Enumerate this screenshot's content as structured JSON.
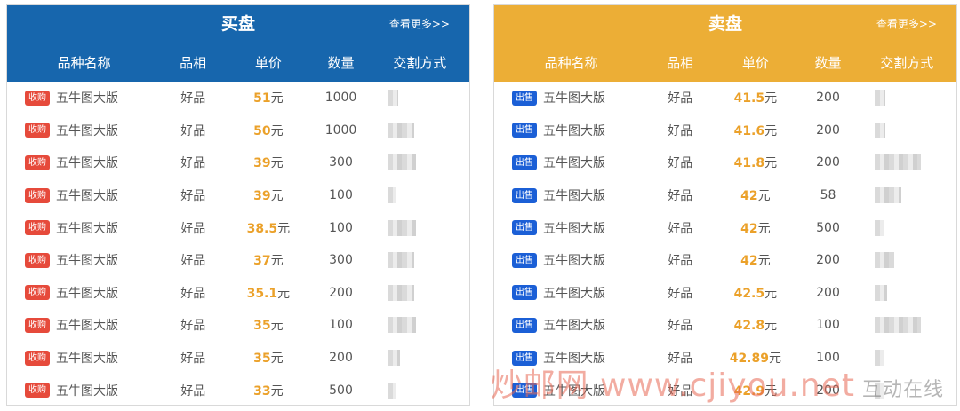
{
  "buy": {
    "title": "买盘",
    "more": "查看更多>>",
    "columns": [
      "品种名称",
      "品相",
      "单价",
      "数量",
      "交割方式"
    ],
    "rows": [
      {
        "tag": "收购",
        "name": "五牛图大版",
        "quality": "好品",
        "price": "51",
        "unit": "元",
        "qty": "1000"
      },
      {
        "tag": "收购",
        "name": "五牛图大版",
        "quality": "好品",
        "price": "50",
        "unit": "元",
        "qty": "1000"
      },
      {
        "tag": "收购",
        "name": "五牛图大版",
        "quality": "好品",
        "price": "39",
        "unit": "元",
        "qty": "300"
      },
      {
        "tag": "收购",
        "name": "五牛图大版",
        "quality": "好品",
        "price": "39",
        "unit": "元",
        "qty": "100"
      },
      {
        "tag": "收购",
        "name": "五牛图大版",
        "quality": "好品",
        "price": "38.5",
        "unit": "元",
        "qty": "100"
      },
      {
        "tag": "收购",
        "name": "五牛图大版",
        "quality": "好品",
        "price": "37",
        "unit": "元",
        "qty": "300"
      },
      {
        "tag": "收购",
        "name": "五牛图大版",
        "quality": "好品",
        "price": "35.1",
        "unit": "元",
        "qty": "200"
      },
      {
        "tag": "收购",
        "name": "五牛图大版",
        "quality": "好品",
        "price": "35",
        "unit": "元",
        "qty": "100"
      },
      {
        "tag": "收购",
        "name": "五牛图大版",
        "quality": "好品",
        "price": "35",
        "unit": "元",
        "qty": "200"
      },
      {
        "tag": "收购",
        "name": "五牛图大版",
        "quality": "好品",
        "price": "33",
        "unit": "元",
        "qty": "500"
      }
    ]
  },
  "sell": {
    "title": "卖盘",
    "more": "查看更多>>",
    "columns": [
      "品种名称",
      "品相",
      "单价",
      "数量",
      "交割方式"
    ],
    "rows": [
      {
        "tag": "出售",
        "name": "五牛图大版",
        "quality": "好品",
        "price": "41.5",
        "unit": "元",
        "qty": "200"
      },
      {
        "tag": "出售",
        "name": "五牛图大版",
        "quality": "好品",
        "price": "41.6",
        "unit": "元",
        "qty": "200"
      },
      {
        "tag": "出售",
        "name": "五牛图大版",
        "quality": "好品",
        "price": "41.8",
        "unit": "元",
        "qty": "200"
      },
      {
        "tag": "出售",
        "name": "五牛图大版",
        "quality": "好品",
        "price": "42",
        "unit": "元",
        "qty": "58"
      },
      {
        "tag": "出售",
        "name": "五牛图大版",
        "quality": "好品",
        "price": "42",
        "unit": "元",
        "qty": "500"
      },
      {
        "tag": "出售",
        "name": "五牛图大版",
        "quality": "好品",
        "price": "42",
        "unit": "元",
        "qty": "200"
      },
      {
        "tag": "出售",
        "name": "五牛图大版",
        "quality": "好品",
        "price": "42.5",
        "unit": "元",
        "qty": "200"
      },
      {
        "tag": "出售",
        "name": "五牛图大版",
        "quality": "好品",
        "price": "42.8",
        "unit": "元",
        "qty": "100"
      },
      {
        "tag": "出售",
        "name": "五牛图大版",
        "quality": "好品",
        "price": "42.89",
        "unit": "元",
        "qty": "100"
      },
      {
        "tag": "出售",
        "name": "五牛图大版",
        "quality": "好品",
        "price": "42.9",
        "unit": "元",
        "qty": "200"
      }
    ]
  },
  "watermark": {
    "text": "炒邮网 www.cjiyou.net",
    "badge": "互动在线"
  },
  "colors": {
    "buy_header": "#1766ad",
    "sell_header": "#ecae36",
    "price": "#eba12a",
    "buy_tag": "#e64a3b",
    "sell_tag": "#1b5fd6"
  }
}
